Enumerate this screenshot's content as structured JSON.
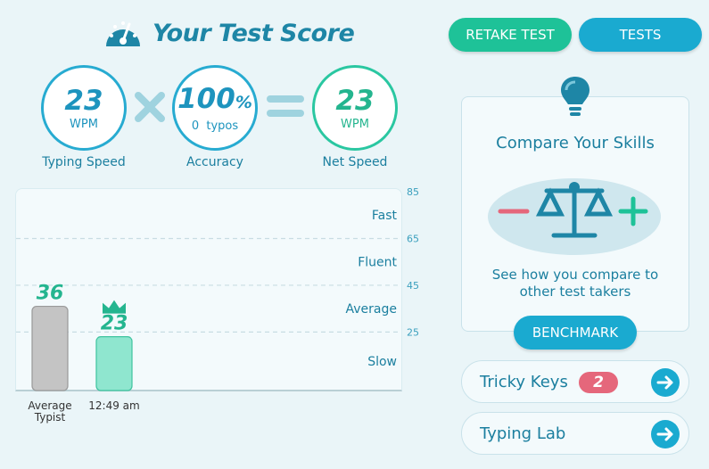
{
  "header": {
    "title": "Your Test Score",
    "retake_label": "RETAKE TEST",
    "tests_label": "TESTS"
  },
  "scores": {
    "typing_speed": {
      "value": "23",
      "unit": "WPM",
      "caption": "Typing Speed"
    },
    "accuracy": {
      "value": "100",
      "percent": "%",
      "sub": "0  typos",
      "caption": "Accuracy"
    },
    "net_speed": {
      "value": "23",
      "unit": "WPM",
      "caption": "Net Speed"
    }
  },
  "chart": {
    "ticks": [
      "85",
      "65",
      "45",
      "25"
    ],
    "zones": [
      "Fast",
      "Fluent",
      "Average",
      "Slow"
    ]
  },
  "chart_data": {
    "type": "bar",
    "categories": [
      "Average Typist",
      "12:49 am"
    ],
    "values": [
      36,
      23
    ],
    "ylim": [
      0,
      85
    ],
    "yticks": [
      25,
      45,
      65,
      85
    ],
    "zones": [
      {
        "label": "Slow",
        "range": [
          0,
          25
        ]
      },
      {
        "label": "Average",
        "range": [
          25,
          45
        ]
      },
      {
        "label": "Fluent",
        "range": [
          45,
          65
        ]
      },
      {
        "label": "Fast",
        "range": [
          65,
          85
        ]
      }
    ],
    "bar_labels": [
      "36",
      "23"
    ],
    "category_labels": [
      "Average\nTypist",
      "12:49 am"
    ],
    "colors": [
      "#c4c4c4",
      "#8fe6cf"
    ]
  },
  "compare": {
    "title": "Compare Your Skills",
    "description": "See how you compare to other test takers",
    "button_label": "BENCHMARK"
  },
  "links": {
    "tricky_keys": {
      "label": "Tricky Keys",
      "badge": "2"
    },
    "typing_lab": {
      "label": "Typing Lab"
    }
  },
  "colors": {
    "teal": "#1ec298",
    "blue": "#1aaad0",
    "badge": "#e5677b"
  }
}
